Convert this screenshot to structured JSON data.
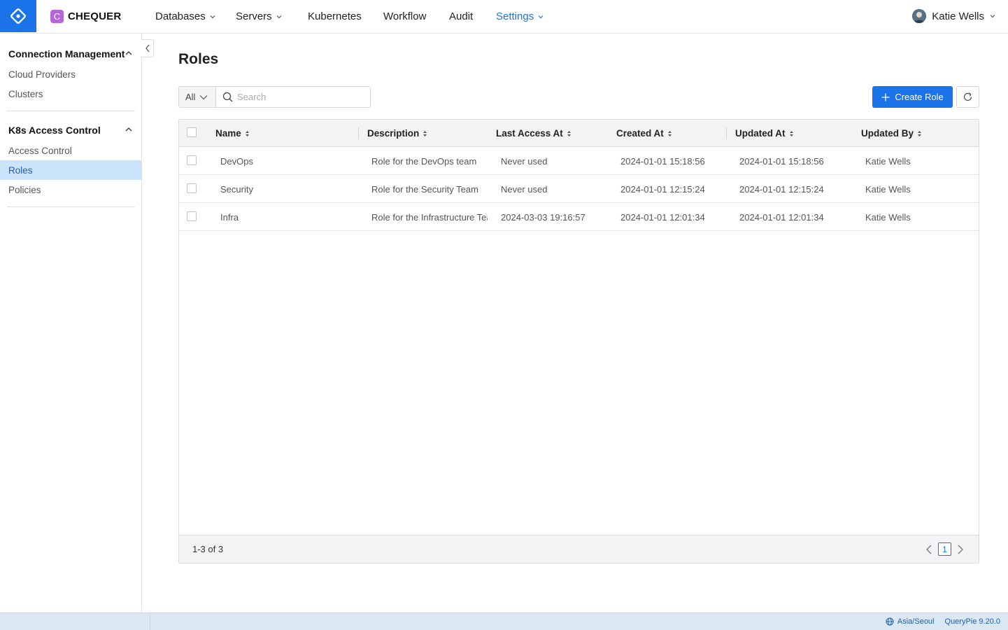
{
  "brand": {
    "org_initial": "C",
    "org_name": "CHEQUER"
  },
  "nav": {
    "items": [
      {
        "label": "Databases",
        "dropdown": true
      },
      {
        "label": "Servers",
        "dropdown": true
      },
      {
        "label": "Kubernetes",
        "dropdown": false
      },
      {
        "label": "Workflow",
        "dropdown": false
      },
      {
        "label": "Audit",
        "dropdown": false
      },
      {
        "label": "Settings",
        "dropdown": true,
        "active": true
      }
    ],
    "user": "Katie Wells"
  },
  "sidebar": {
    "sections": [
      {
        "title": "Connection Management",
        "items": [
          "Cloud Providers",
          "Clusters"
        ]
      },
      {
        "title": "K8s Access Control",
        "items": [
          "Access Control",
          "Roles",
          "Policies"
        ],
        "active_item": "Roles"
      }
    ]
  },
  "page": {
    "title": "Roles",
    "filter_value": "All",
    "search_placeholder": "Search",
    "create_label": "Create Role"
  },
  "table": {
    "columns": [
      "Name",
      "Description",
      "Last Access At",
      "Created At",
      "Updated At",
      "Updated By"
    ],
    "rows": [
      {
        "name": "DevOps",
        "description": "Role for the DevOps team",
        "last_access": "Never used",
        "created": "2024-01-01 15:18:56",
        "updated": "2024-01-01 15:18:56",
        "updated_by": "Katie Wells"
      },
      {
        "name": "Security",
        "description": "Role for the Security Team",
        "last_access": "Never used",
        "created": "2024-01-01 12:15:24",
        "updated": "2024-01-01 12:15:24",
        "updated_by": "Katie Wells"
      },
      {
        "name": "Infra",
        "description": "Role for the Infrastructure Team",
        "last_access": "2024-03-03 19:16:57",
        "created": "2024-01-01 12:01:34",
        "updated": "2024-01-01 12:01:34",
        "updated_by": "Katie Wells"
      }
    ],
    "range_text": "1-3 of 3",
    "current_page": "1"
  },
  "status": {
    "timezone": "Asia/Seoul",
    "version": "QueryPie 9.20.0"
  },
  "colors": {
    "accent": "#1a73e8",
    "org_badge": "#b565d9",
    "active_bg": "#cce4fb"
  }
}
